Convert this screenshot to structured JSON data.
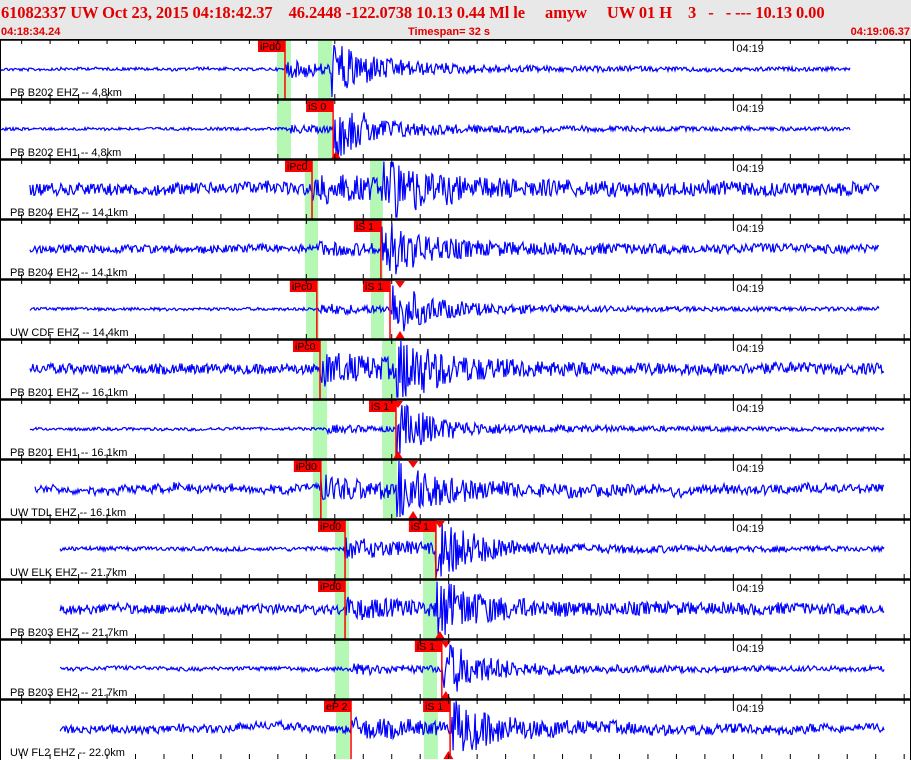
{
  "header": {
    "title": "61082337 UW Oct 23, 2015 04:18:42.37    46.2448 -122.0738 10.13 0.44 Ml le     amyw     UW 01 H    3   -   - --- 10.13 0.00",
    "start_time": "04:18:34.24",
    "timespan_label": "Timespan=  32 s",
    "end_time": "04:19:06.37"
  },
  "axis": {
    "minute_label": "04:19",
    "minute_mark_s": 25.76,
    "timespan_s": 32
  },
  "colors": {
    "trace": "#0000ff",
    "pick": "#ff0000",
    "window": "#b4f8b4",
    "header_text": "#e00000"
  },
  "traces": [
    {
      "label": "PB B202 EHZ -- 4,8km",
      "range": [
        0,
        29.86
      ],
      "p_window": [
        9.73,
        10.22
      ],
      "s_window": [
        11.17,
        11.66
      ],
      "picks": [
        {
          "label": "iPd0",
          "t": 10.01
        }
      ],
      "markers": []
    },
    {
      "label": "PB B202 EH1 -- 4,8km",
      "range": [
        0,
        29.86
      ],
      "p_window": [
        9.73,
        10.22
      ],
      "s_window": [
        11.17,
        11.66
      ],
      "picks": [
        {
          "label": "iS 0",
          "t": 11.7
        }
      ],
      "markers": [
        {
          "t": 11.8,
          "dir": "up"
        }
      ]
    },
    {
      "label": "PB B204 EHZ -- 14.1km",
      "range": [
        1.05,
        30.9
      ],
      "p_window": [
        10.71,
        11.17
      ],
      "s_window": [
        13.0,
        13.45
      ],
      "picks": [
        {
          "label": "iPc0",
          "t": 10.96
        }
      ],
      "markers": []
    },
    {
      "label": "PB B204 EH2 -- 14.1km",
      "range": [
        1.05,
        30.9
      ],
      "p_window": [
        10.71,
        11.17
      ],
      "s_window": [
        13.0,
        13.45
      ],
      "picks": [
        {
          "label": "iS 1",
          "t": 13.38
        }
      ],
      "markers": []
    },
    {
      "label": "UW CDF EHZ -- 14.4km",
      "range": [
        1.05,
        30.9
      ],
      "p_window": [
        10.75,
        11.2
      ],
      "s_window": [
        13.03,
        13.49
      ],
      "picks": [
        {
          "label": "iPc0",
          "t": 11.13
        },
        {
          "label": "iS 1",
          "t": 13.7
        }
      ],
      "markers": [
        {
          "t": 14.05,
          "dir": "down"
        },
        {
          "t": 14.05,
          "dir": "up"
        }
      ]
    },
    {
      "label": "PB B201 EHZ -- 16.1km",
      "range": [
        1.05,
        31.08
      ],
      "p_window": [
        10.99,
        11.49
      ],
      "s_window": [
        13.42,
        13.91
      ],
      "picks": [
        {
          "label": "iPc0",
          "t": 11.24
        }
      ],
      "markers": []
    },
    {
      "label": "PB B201 EH1 -- 16.1km",
      "range": [
        1.05,
        31.08
      ],
      "p_window": [
        10.99,
        11.49
      ],
      "s_window": [
        13.42,
        13.91
      ],
      "picks": [
        {
          "label": "iS 1",
          "t": 13.91
        }
      ],
      "markers": [
        {
          "t": 13.98,
          "dir": "down"
        },
        {
          "t": 13.98,
          "dir": "up"
        }
      ]
    },
    {
      "label": "UW TDL EHZ -- 16.1km",
      "range": [
        1.23,
        31.08
      ],
      "p_window": [
        10.99,
        11.49
      ],
      "s_window": [
        13.45,
        13.94
      ],
      "picks": [
        {
          "label": "iPd0",
          "t": 11.27
        }
      ],
      "markers": [
        {
          "t": 14.51,
          "dir": "down"
        },
        {
          "t": 14.51,
          "dir": "up"
        }
      ]
    },
    {
      "label": "UW ELK EHZ -- 21.7km",
      "range": [
        2.11,
        31.08
      ],
      "p_window": [
        11.77,
        12.26
      ],
      "s_window": [
        14.86,
        15.35
      ],
      "picks": [
        {
          "label": "iPd0",
          "t": 12.12
        },
        {
          "label": "iS 1",
          "t": 15.31
        }
      ],
      "markers": [
        {
          "t": 15.45,
          "dir": "down"
        }
      ]
    },
    {
      "label": "PB B203 EHZ -- 21.7km",
      "range": [
        2.11,
        31.08
      ],
      "p_window": [
        11.77,
        12.26
      ],
      "s_window": [
        14.86,
        15.35
      ],
      "picks": [
        {
          "label": "iPd0",
          "t": 12.12
        }
      ],
      "markers": [
        {
          "t": 15.45,
          "dir": "up"
        }
      ]
    },
    {
      "label": "PB B203 EH2 -- 21.7km",
      "range": [
        2.11,
        31.08
      ],
      "p_window": [
        11.77,
        12.26
      ],
      "s_window": [
        14.86,
        15.35
      ],
      "picks": [
        {
          "label": "iS 1",
          "t": 15.52
        }
      ],
      "markers": [
        {
          "t": 15.66,
          "dir": "down"
        },
        {
          "t": 15.66,
          "dir": "up"
        }
      ]
    },
    {
      "label": "UW FL2 EHZ -- 22.0km",
      "range": [
        2.11,
        31.08
      ],
      "p_window": [
        11.8,
        12.29
      ],
      "s_window": [
        14.89,
        15.38
      ],
      "picks": [
        {
          "label": "eP 2",
          "t": 12.33
        },
        {
          "label": "iS 1",
          "t": 15.81
        }
      ],
      "markers": [
        {
          "t": 15.75,
          "dir": "up"
        }
      ]
    }
  ]
}
